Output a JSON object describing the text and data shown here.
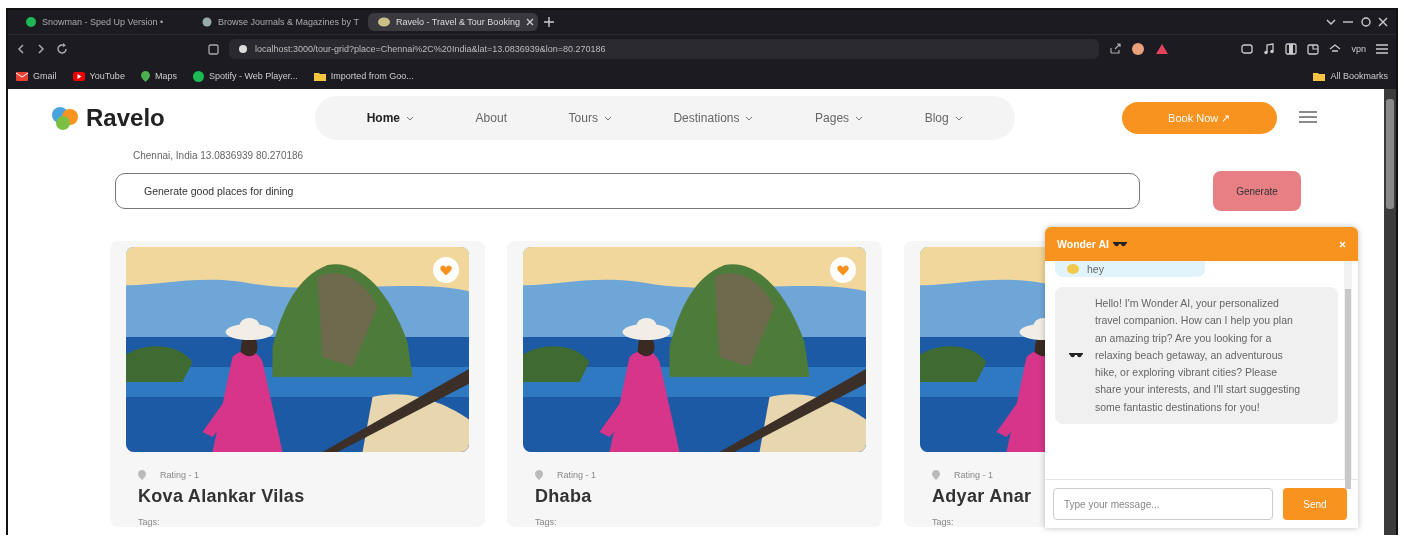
{
  "browser": {
    "tabs": [
      {
        "title": "Snowman - Sped Up Version •",
        "kind": "music",
        "selected": false
      },
      {
        "title": "Browse Journals & Magazines by T",
        "kind": "journal",
        "selected": false
      },
      {
        "title": "Ravelo - Travel & Tour Booking",
        "kind": "site",
        "selected": true
      }
    ],
    "address": {
      "url": "localhost:3000/tour-grid?place=Chennai%2C%20India&lat=13.0836939&lon=80.270186"
    },
    "vpn": "vpn",
    "bookmarks": [
      {
        "label": "Gmail",
        "kind": "mail"
      },
      {
        "label": "YouTube",
        "kind": "video"
      },
      {
        "label": "Maps",
        "kind": "map"
      },
      {
        "label": "Spotify - Web Player...",
        "kind": "music"
      },
      {
        "label": "Imported from Goo...",
        "kind": "folder"
      }
    ],
    "all_bookmarks": "All Bookmarks"
  },
  "header": {
    "logo": "Ravelo",
    "nav": [
      {
        "label": "Home",
        "dropdown": true,
        "selected": true
      },
      {
        "label": "About",
        "dropdown": false,
        "selected": false
      },
      {
        "label": "Tours",
        "dropdown": true,
        "selected": false
      },
      {
        "label": "Destinations",
        "dropdown": true,
        "selected": false
      },
      {
        "label": "Pages",
        "dropdown": true,
        "selected": false
      },
      {
        "label": "Blog",
        "dropdown": true,
        "selected": false
      }
    ],
    "book_button": "Book Now ↗"
  },
  "location": "Chennai, India 13.0836939 80.270186",
  "search": {
    "value": "Generate good places for dining",
    "button": "Generate"
  },
  "tours": [
    {
      "rating": "Rating - 1",
      "name": "Kova Alankar Vilas",
      "tags_label": "Tags:"
    },
    {
      "rating": "Rating - 1",
      "name": "Dhaba",
      "tags_label": "Tags:"
    },
    {
      "rating": "Rating - 1",
      "name": "Adyar Anar",
      "tags_label": "Tags:"
    }
  ],
  "chat": {
    "title": "Wonder AI",
    "messages": [
      {
        "kind": "user",
        "text": "hey"
      },
      {
        "kind": "bot",
        "text": "Hello! I'm Wonder AI, your personalized travel companion. How can I help you plan an amazing trip? Are you looking for a relaxing beach getaway, an adventurous hike, or exploring vibrant cities? Please share your interests, and I'll start suggesting some fantastic destinations for you!"
      }
    ],
    "input": {
      "placeholder": "Type your message..."
    },
    "send": "Send"
  }
}
